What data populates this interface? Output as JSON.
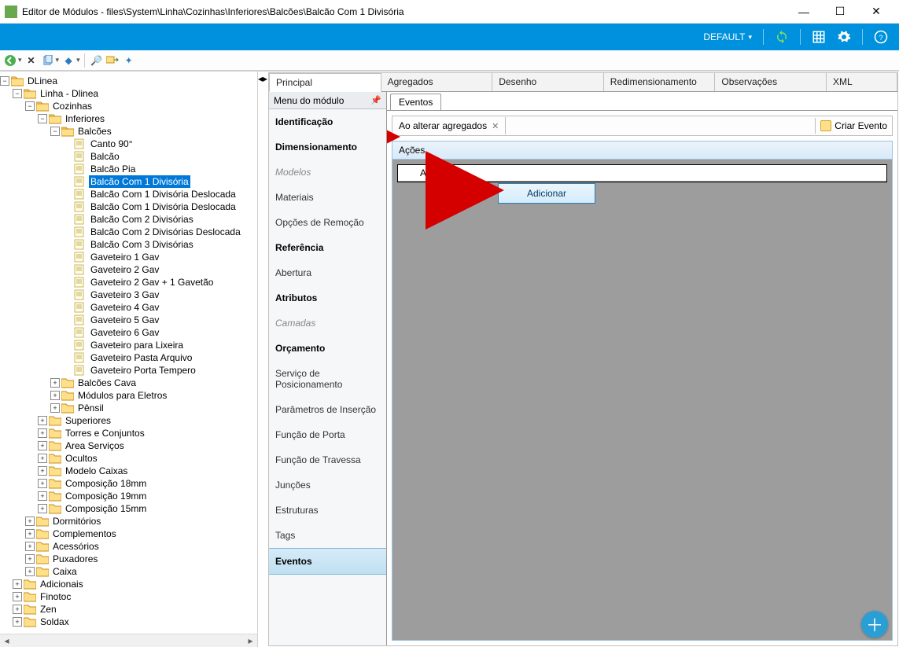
{
  "window": {
    "title": "Editor de Módulos - files\\System\\Linha\\Cozinhas\\Inferiores\\Balcões\\Balcão Com 1 Divisória"
  },
  "ribbon": {
    "profile": "DEFAULT"
  },
  "tree": [
    {
      "d": 0,
      "t": "-",
      "k": "f",
      "l": "DLinea"
    },
    {
      "d": 1,
      "t": "-",
      "k": "fo",
      "l": "Linha - Dlinea"
    },
    {
      "d": 2,
      "t": "-",
      "k": "fo",
      "l": "Cozinhas"
    },
    {
      "d": 3,
      "t": "-",
      "k": "fo",
      "l": "Inferiores"
    },
    {
      "d": 4,
      "t": "-",
      "k": "fo",
      "l": "Balcões"
    },
    {
      "d": 5,
      "t": "",
      "k": "i",
      "l": "Canto 90°"
    },
    {
      "d": 5,
      "t": "",
      "k": "i",
      "l": "Balcão"
    },
    {
      "d": 5,
      "t": "",
      "k": "i",
      "l": "Balcão Pia"
    },
    {
      "d": 5,
      "t": "",
      "k": "i",
      "l": "Balcão Com 1 Divisória",
      "sel": true
    },
    {
      "d": 5,
      "t": "",
      "k": "i",
      "l": "Balcão Com 1 Divisória Deslocada"
    },
    {
      "d": 5,
      "t": "",
      "k": "i",
      "l": "Balcão Com 1 Divisória Deslocada"
    },
    {
      "d": 5,
      "t": "",
      "k": "i",
      "l": "Balcão Com 2 Divisórias"
    },
    {
      "d": 5,
      "t": "",
      "k": "i",
      "l": "Balcão Com 2 Divisórias Deslocada"
    },
    {
      "d": 5,
      "t": "",
      "k": "i",
      "l": "Balcão Com 3 Divisórias"
    },
    {
      "d": 5,
      "t": "",
      "k": "i",
      "l": "Gaveteiro 1 Gav"
    },
    {
      "d": 5,
      "t": "",
      "k": "i",
      "l": "Gaveteiro 2 Gav"
    },
    {
      "d": 5,
      "t": "",
      "k": "i",
      "l": "Gaveteiro 2 Gav + 1 Gavetão"
    },
    {
      "d": 5,
      "t": "",
      "k": "i",
      "l": "Gaveteiro 3 Gav"
    },
    {
      "d": 5,
      "t": "",
      "k": "i",
      "l": "Gaveteiro 4 Gav"
    },
    {
      "d": 5,
      "t": "",
      "k": "i",
      "l": "Gaveteiro 5 Gav"
    },
    {
      "d": 5,
      "t": "",
      "k": "i",
      "l": "Gaveteiro 6 Gav"
    },
    {
      "d": 5,
      "t": "",
      "k": "i",
      "l": "Gaveteiro para Lixeira"
    },
    {
      "d": 5,
      "t": "",
      "k": "i",
      "l": "Gaveteiro Pasta Arquivo"
    },
    {
      "d": 5,
      "t": "",
      "k": "i",
      "l": "Gaveteiro Porta Tempero"
    },
    {
      "d": 4,
      "t": "+",
      "k": "fc",
      "l": "Balcões Cava"
    },
    {
      "d": 4,
      "t": "+",
      "k": "fc",
      "l": "Módulos para Eletros"
    },
    {
      "d": 4,
      "t": "+",
      "k": "fc",
      "l": "Pênsil"
    },
    {
      "d": 3,
      "t": "+",
      "k": "fc",
      "l": "Superiores"
    },
    {
      "d": 3,
      "t": "+",
      "k": "fc",
      "l": "Torres e Conjuntos"
    },
    {
      "d": 3,
      "t": "+",
      "k": "fc",
      "l": "Area Serviços"
    },
    {
      "d": 3,
      "t": "+",
      "k": "fc",
      "l": "Ocultos"
    },
    {
      "d": 3,
      "t": "+",
      "k": "fc",
      "l": "Modelo Caixas"
    },
    {
      "d": 3,
      "t": "+",
      "k": "fc",
      "l": "Composição 18mm"
    },
    {
      "d": 3,
      "t": "+",
      "k": "fc",
      "l": "Composição 19mm"
    },
    {
      "d": 3,
      "t": "+",
      "k": "fc",
      "l": "Composição 15mm"
    },
    {
      "d": 2,
      "t": "+",
      "k": "fc",
      "l": "Dormitórios"
    },
    {
      "d": 2,
      "t": "+",
      "k": "fc",
      "l": "Complementos"
    },
    {
      "d": 2,
      "t": "+",
      "k": "fc",
      "l": "Acessórios"
    },
    {
      "d": 2,
      "t": "+",
      "k": "fc",
      "l": "Puxadores"
    },
    {
      "d": 2,
      "t": "+",
      "k": "fc",
      "l": "Caixa"
    },
    {
      "d": 1,
      "t": "+",
      "k": "fc",
      "l": "Adicionais"
    },
    {
      "d": 1,
      "t": "+",
      "k": "fc",
      "l": "Finotoc"
    },
    {
      "d": 1,
      "t": "+",
      "k": "fc",
      "l": "Zen"
    },
    {
      "d": 1,
      "t": "+",
      "k": "fc",
      "l": "Soldax"
    }
  ],
  "tabs": {
    "top": [
      "Principal",
      "Agregados",
      "Desenho",
      "Redimensionamento",
      "Observações",
      "XML"
    ],
    "activeTop": 0,
    "sub": "Eventos"
  },
  "modmenu": {
    "header": "Menu do módulo",
    "items": [
      {
        "l": "Identificação",
        "h": true
      },
      {
        "l": "Dimensionamento",
        "h": true
      },
      {
        "l": "Modelos",
        "m": true
      },
      {
        "l": "Materiais"
      },
      {
        "l": "Opções de Remoção"
      },
      {
        "l": "Referência",
        "h": true
      },
      {
        "l": "Abertura"
      },
      {
        "l": "Atributos",
        "h": true
      },
      {
        "l": "Camadas",
        "m": true
      },
      {
        "l": "Orçamento",
        "h": true
      },
      {
        "l": "Serviço de Posicionamento"
      },
      {
        "l": "Parâmetros de Inserção"
      },
      {
        "l": "Função de Porta"
      },
      {
        "l": "Função de Travessa"
      },
      {
        "l": "Junções"
      },
      {
        "l": "Estruturas"
      },
      {
        "l": "Tags"
      },
      {
        "l": "Eventos",
        "h": true,
        "sel": true
      }
    ]
  },
  "events": {
    "tabLabel": "Ao alterar agregados",
    "createLabel": "Criar Evento",
    "sectionHeader": "Ações",
    "columnHeader": "Ação",
    "contextItem": "Adicionar"
  }
}
